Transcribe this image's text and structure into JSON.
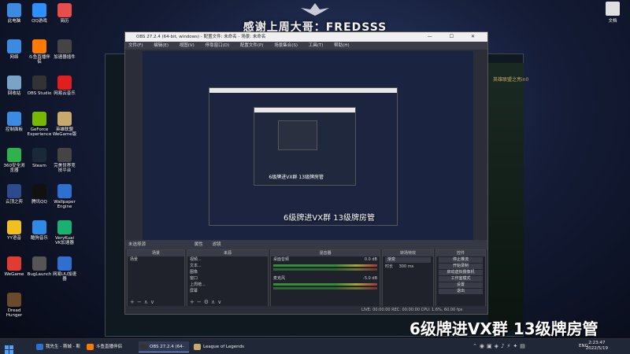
{
  "banner": {
    "text": "感谢上周大哥：FREDSSS"
  },
  "desktop": {
    "icons": [
      {
        "label": "此电脑",
        "color": "#3b8be0"
      },
      {
        "label": "QQ游戏",
        "color": "#2e90ff"
      },
      {
        "label": "简历",
        "color": "#e84c4c"
      },
      {
        "label": "网络",
        "color": "#3b8be0"
      },
      {
        "label": "斗鱼直播伴侣",
        "color": "#ff7a00"
      },
      {
        "label": "加速器插件",
        "color": "#444"
      },
      {
        "label": "回收站",
        "color": "#7aa3c8"
      },
      {
        "label": "OBS Studio",
        "color": "#333"
      },
      {
        "label": "网易云音乐",
        "color": "#e02020"
      },
      {
        "label": "控制面板",
        "color": "#3b8be0"
      },
      {
        "label": "GeForce Experience",
        "color": "#76b900"
      },
      {
        "label": "英雄联盟WeGame版",
        "color": "#c8aa6e"
      },
      {
        "label": "360安全浏览器",
        "color": "#2fb24c"
      },
      {
        "label": "Steam",
        "color": "#1b2838"
      },
      {
        "label": "完美世界竞技平台",
        "color": "#444"
      },
      {
        "label": "云顶之弈",
        "color": "#2c4a8c"
      },
      {
        "label": "腾讯QQ",
        "color": "#111"
      },
      {
        "label": "Wallpaper Engine",
        "color": "#2e6fd0"
      },
      {
        "label": "YY语音",
        "color": "#f0c020"
      },
      {
        "label": "酷狗音乐",
        "color": "#2e8ae6"
      },
      {
        "label": "VeryKuai VK加速器",
        "color": "#1ab070"
      },
      {
        "label": "WeGame",
        "color": "#e03c31"
      },
      {
        "label": "BugLaunch",
        "color": "#555"
      },
      {
        "label": "网易UU加速器",
        "color": "#2e6fd0"
      },
      {
        "label": "Dread Hunger",
        "color": "#6a4a2a"
      }
    ],
    "right_icon": {
      "label": "文档"
    }
  },
  "obs": {
    "title": "OBS 27.2.4 (64-bit, windows) - 配置文件: 未命名 - 场景: 未命名",
    "window_buttons": "— ☐ ✕",
    "menu": [
      "文件(F)",
      "编辑(E)",
      "视图(V)",
      "停靠窗口(D)",
      "配置文件(P)",
      "场景集合(S)",
      "工具(T)",
      "帮助(H)"
    ],
    "source_bar": {
      "label": "未选择源",
      "props": "属性",
      "filters": "滤镜"
    },
    "docks": {
      "scenes": {
        "header": "场景",
        "items": [
          "场景"
        ]
      },
      "sources": {
        "header": "来源",
        "items": [
          "视频...",
          "文本...",
          "图像",
          "窗口",
          "上周榜...",
          "屏幕"
        ]
      },
      "mixer": {
        "header": "混音器",
        "ch1": "桌面音频",
        "ch1_db": "0.0 dB",
        "ch2": "麦克风",
        "ch2_db": "-5.0 dB"
      },
      "transitions": {
        "header": "转场特效",
        "type": "渐变",
        "duration_label": "时长",
        "duration": "300 ms"
      },
      "controls": {
        "header": "控件",
        "buttons": [
          "停止推流",
          "开始录制",
          "启动虚拟摄像机",
          "工作室模式",
          "设置",
          "退出"
        ]
      }
    },
    "status": "LIVE: 00:00:00   REC: 00:00:00   CPU: 1.6%, 60.00 fps"
  },
  "league": {
    "label": "英雄联盟之亮in0"
  },
  "subtitles": {
    "big": "6级牌进VX群  13级牌房管",
    "mid": "6级牌进VX群  13级牌房管",
    "small": "6级牌进VX群  13级牌房管"
  },
  "taskbar": {
    "items": [
      {
        "label": "我先生 - 斯城 - 斯城...",
        "color": "#2e6fd0"
      },
      {
        "label": "斗鱼直播伴侣",
        "color": "#ff7a00"
      },
      {
        "label": "OBS 27.2.4 (64-bit...",
        "color": "#333"
      },
      {
        "label": "League of Legends",
        "color": "#c8aa6e"
      }
    ],
    "lang": "ENG",
    "time": "2:23:47",
    "date": "2022/5/19"
  }
}
